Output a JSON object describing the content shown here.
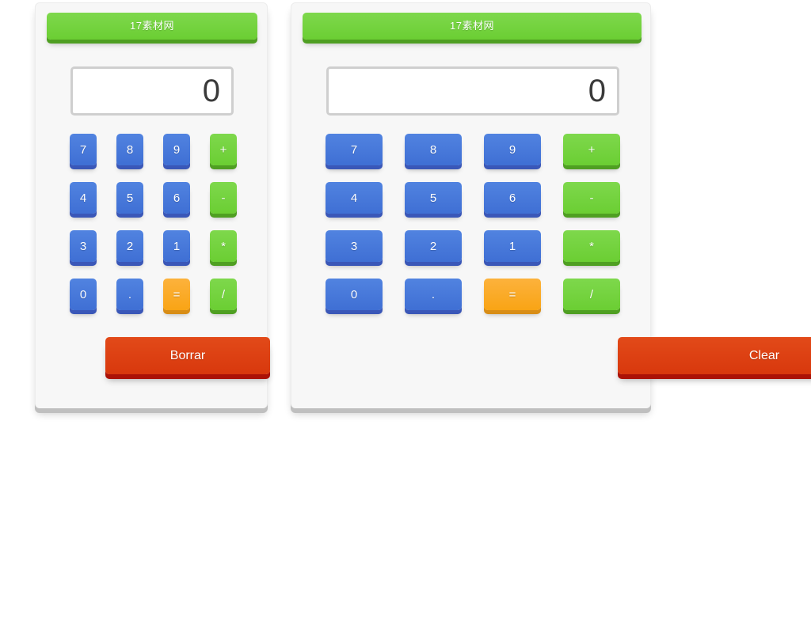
{
  "page": {
    "background_color": "#ffffff",
    "card_background": "#f7f7f7"
  },
  "colors": {
    "number_key": "#4476d8",
    "number_key_edge": "#3a57b8",
    "operator_key": "#72d43f",
    "operator_key_edge": "#4f9f22",
    "equals_key": "#f9a415",
    "equals_key_edge": "#d88d16",
    "clear_button": "#d93c14",
    "clear_button_edge": "#ab1207",
    "display_text": "#3a3a3a",
    "display_border": "#cfcfcf"
  },
  "calculators": [
    {
      "id": "calculator-left",
      "brand": {
        "label": "17素材网"
      },
      "display": {
        "value": "0",
        "placeholder": "0"
      },
      "keys": [
        {
          "label": "7",
          "type": "num",
          "name": "key-7"
        },
        {
          "label": "8",
          "type": "num",
          "name": "key-8"
        },
        {
          "label": "9",
          "type": "num",
          "name": "key-9"
        },
        {
          "label": "+",
          "type": "op",
          "name": "key-add"
        },
        {
          "label": "4",
          "type": "num",
          "name": "key-4"
        },
        {
          "label": "5",
          "type": "num",
          "name": "key-5"
        },
        {
          "label": "6",
          "type": "num",
          "name": "key-6"
        },
        {
          "label": "-",
          "type": "op",
          "name": "key-subtract"
        },
        {
          "label": "3",
          "type": "num",
          "name": "key-3"
        },
        {
          "label": "2",
          "type": "num",
          "name": "key-2"
        },
        {
          "label": "1",
          "type": "num",
          "name": "key-1"
        },
        {
          "label": "*",
          "type": "op",
          "name": "key-multiply"
        },
        {
          "label": "0",
          "type": "num",
          "name": "key-0"
        },
        {
          "label": ".",
          "type": "num",
          "name": "key-decimal"
        },
        {
          "label": "=",
          "type": "eq",
          "name": "key-equals"
        },
        {
          "label": "/",
          "type": "op",
          "name": "key-divide"
        }
      ],
      "clear": {
        "label": "Borrar"
      }
    },
    {
      "id": "calculator-right",
      "brand": {
        "label": "17素材网"
      },
      "display": {
        "value": "0",
        "placeholder": "0"
      },
      "keys": [
        {
          "label": "7",
          "type": "num",
          "name": "key-7"
        },
        {
          "label": "8",
          "type": "num",
          "name": "key-8"
        },
        {
          "label": "9",
          "type": "num",
          "name": "key-9"
        },
        {
          "label": "+",
          "type": "op",
          "name": "key-add"
        },
        {
          "label": "4",
          "type": "num",
          "name": "key-4"
        },
        {
          "label": "5",
          "type": "num",
          "name": "key-5"
        },
        {
          "label": "6",
          "type": "num",
          "name": "key-6"
        },
        {
          "label": "-",
          "type": "op",
          "name": "key-subtract"
        },
        {
          "label": "3",
          "type": "num",
          "name": "key-3"
        },
        {
          "label": "2",
          "type": "num",
          "name": "key-2"
        },
        {
          "label": "1",
          "type": "num",
          "name": "key-1"
        },
        {
          "label": "*",
          "type": "op",
          "name": "key-multiply"
        },
        {
          "label": "0",
          "type": "num",
          "name": "key-0"
        },
        {
          "label": ".",
          "type": "num",
          "name": "key-decimal"
        },
        {
          "label": "=",
          "type": "eq",
          "name": "key-equals"
        },
        {
          "label": "/",
          "type": "op",
          "name": "key-divide"
        }
      ],
      "clear": {
        "label": "Clear"
      }
    }
  ]
}
